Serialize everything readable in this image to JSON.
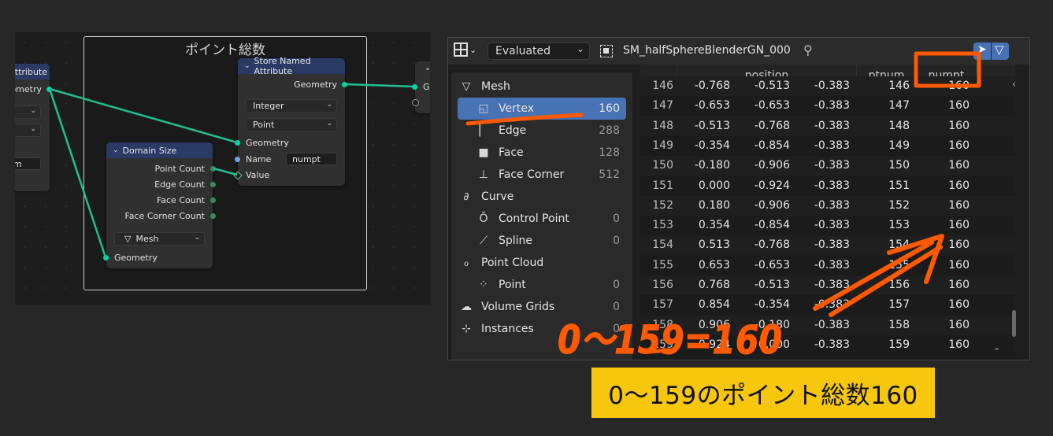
{
  "node_editor": {
    "frame_title": "ポイント総数",
    "left_node": {
      "title_fragment": "Attribute",
      "geometry_fragment": "eometry",
      "field_fragment": "m"
    },
    "store_node": {
      "title": "Store Named Attribute",
      "out_geometry": "Geometry",
      "type": "Integer",
      "domain": "Point",
      "in_geometry": "Geometry",
      "name_label": "Name",
      "name_value": "numpt",
      "value_label": "Value"
    },
    "domain_size_node": {
      "title": "Domain Size",
      "outputs": [
        "Point Count",
        "Edge Count",
        "Face Count",
        "Face Corner Count"
      ],
      "component": "Mesh",
      "in_geometry": "Geometry"
    },
    "right_node": {
      "geometry_fragment": "G"
    }
  },
  "spreadsheet": {
    "mode": "Evaluated",
    "object_name": "SM_halfSphereBlenderGN_000",
    "tree": [
      {
        "label": "Mesh",
        "icon": "mesh-icon",
        "count": ""
      },
      {
        "label": "Vertex",
        "icon": "vertex-icon",
        "count": "160",
        "selected": true
      },
      {
        "label": "Edge",
        "icon": "edge-icon",
        "count": "288"
      },
      {
        "label": "Face",
        "icon": "face-icon",
        "count": "128"
      },
      {
        "label": "Face Corner",
        "icon": "face-corner-icon",
        "count": "512"
      },
      {
        "label": "Curve",
        "icon": "curve-icon",
        "count": ""
      },
      {
        "label": "Control Point",
        "icon": "control-point-icon",
        "count": "0"
      },
      {
        "label": "Spline",
        "icon": "spline-icon",
        "count": "0"
      },
      {
        "label": "Point Cloud",
        "icon": "point-cloud-icon",
        "count": ""
      },
      {
        "label": "Point",
        "icon": "point-icon",
        "count": "0"
      },
      {
        "label": "Volume Grids",
        "icon": "volume-icon",
        "count": "0"
      },
      {
        "label": "Instances",
        "icon": "instances-icon",
        "count": "0"
      }
    ],
    "columns": [
      "position",
      "ptnum",
      "numpt"
    ],
    "rows": [
      [
        "146",
        "-0.768",
        "-0.513",
        "-0.383",
        "146",
        "160"
      ],
      [
        "147",
        "-0.653",
        "-0.653",
        "-0.383",
        "147",
        "160"
      ],
      [
        "148",
        "-0.513",
        "-0.768",
        "-0.383",
        "148",
        "160"
      ],
      [
        "149",
        "-0.354",
        "-0.854",
        "-0.383",
        "149",
        "160"
      ],
      [
        "150",
        "-0.180",
        "-0.906",
        "-0.383",
        "150",
        "160"
      ],
      [
        "151",
        "0.000",
        "-0.924",
        "-0.383",
        "151",
        "160"
      ],
      [
        "152",
        "0.180",
        "-0.906",
        "-0.383",
        "152",
        "160"
      ],
      [
        "153",
        "0.354",
        "-0.854",
        "-0.383",
        "153",
        "160"
      ],
      [
        "154",
        "0.513",
        "-0.768",
        "-0.383",
        "154",
        "160"
      ],
      [
        "155",
        "0.653",
        "-0.653",
        "-0.383",
        "155",
        "160"
      ],
      [
        "156",
        "0.768",
        "-0.513",
        "-0.383",
        "156",
        "160"
      ],
      [
        "157",
        "0.854",
        "-0.354",
        "-0.383",
        "157",
        "160"
      ],
      [
        "158",
        "0.906",
        "-0.180",
        "-0.383",
        "158",
        "160"
      ],
      [
        "159",
        "0.924",
        "0.000",
        "-0.383",
        "159",
        "160"
      ]
    ]
  },
  "annotations": {
    "handwritten": "0〜159=160",
    "caption": "0〜159のポイント総数160"
  },
  "colors": {
    "accent_selection": "#4772b3",
    "annotation_orange": "#ff5a00",
    "caption_background": "#f7c70d",
    "geometry_socket": "#00d6a3",
    "node_header": "#2a3a64"
  }
}
